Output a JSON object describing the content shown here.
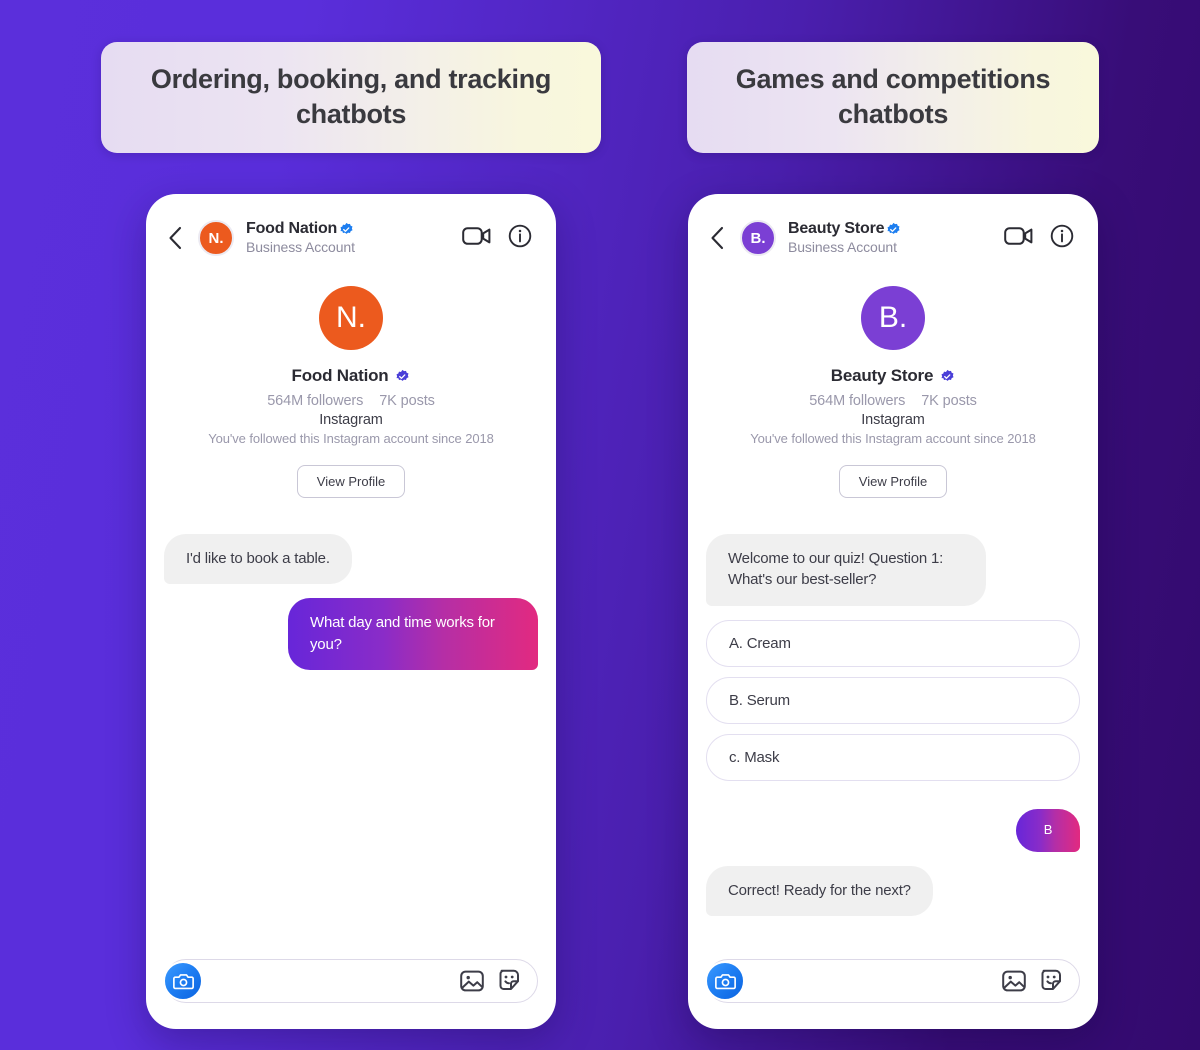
{
  "theme": {
    "bg_gradient_from": "#5b2fdb",
    "bg_gradient_to": "#330a6e",
    "banner_gradient_from": "#e6dcf2",
    "banner_gradient_to": "#f9f8dc",
    "outgoing_bubble_from": "#6726d9",
    "outgoing_bubble_to": "#e22a80",
    "incoming_bubble_bg": "#f0f0f0",
    "verified_header_color": "#1d7ef0",
    "verified_profile_color": "#4a3fd8",
    "camera_button_color": "#1f7ff3"
  },
  "panels": [
    {
      "banner": "Ordering, booking, and tracking chatbots",
      "topbar": {
        "back_icon": "chevron-left-icon",
        "avatar_initials": "N.",
        "avatar_color": "#ec5a1e",
        "name": "Food Nation",
        "verified_icon": "verified-badge-icon",
        "subtitle": "Business Account",
        "video_icon": "video-camera-icon",
        "info_icon": "info-circle-icon"
      },
      "profile": {
        "avatar_initials": "N.",
        "avatar_color": "#ec5a1e",
        "name": "Food Nation",
        "verified_icon": "verified-badge-icon",
        "followers": "564M followers",
        "posts": "7K posts",
        "platform": "Instagram",
        "since": "You've followed this Instagram account since 2018",
        "view_profile_label": "View Profile"
      },
      "messages": [
        {
          "kind": "incoming",
          "text": "I'd like to book a table."
        },
        {
          "kind": "outgoing",
          "text": "What day and time works for you?"
        }
      ],
      "options": [],
      "composer": {
        "placeholder": "",
        "value": "",
        "camera_icon": "camera-icon",
        "photo_icon": "photo-icon",
        "sticker_icon": "sticker-icon"
      }
    },
    {
      "banner": "Games and competitions chatbots",
      "topbar": {
        "back_icon": "chevron-left-icon",
        "avatar_initials": "B.",
        "avatar_color": "#7b3fd4",
        "name": "Beauty Store",
        "verified_icon": "verified-badge-icon",
        "subtitle": "Business Account",
        "video_icon": "video-camera-icon",
        "info_icon": "info-circle-icon"
      },
      "profile": {
        "avatar_initials": "B.",
        "avatar_color": "#7b3fd4",
        "name": "Beauty Store",
        "verified_icon": "verified-badge-icon",
        "followers": "564M followers",
        "posts": "7K posts",
        "platform": "Instagram",
        "since": "You've followed this Instagram account since 2018",
        "view_profile_label": "View Profile"
      },
      "messages": [
        {
          "kind": "incoming",
          "text": "Welcome to our quiz! Question 1: What's our best-seller?"
        },
        {
          "kind": "option",
          "text": "A. Cream"
        },
        {
          "kind": "option",
          "text": "B. Serum"
        },
        {
          "kind": "option",
          "text": "c. Mask"
        },
        {
          "kind": "outgoing-tiny",
          "text": "B"
        },
        {
          "kind": "incoming",
          "text": "Correct! Ready for the next?"
        }
      ],
      "composer": {
        "placeholder": "",
        "value": "",
        "camera_icon": "camera-icon",
        "photo_icon": "photo-icon",
        "sticker_icon": "sticker-icon"
      }
    }
  ]
}
